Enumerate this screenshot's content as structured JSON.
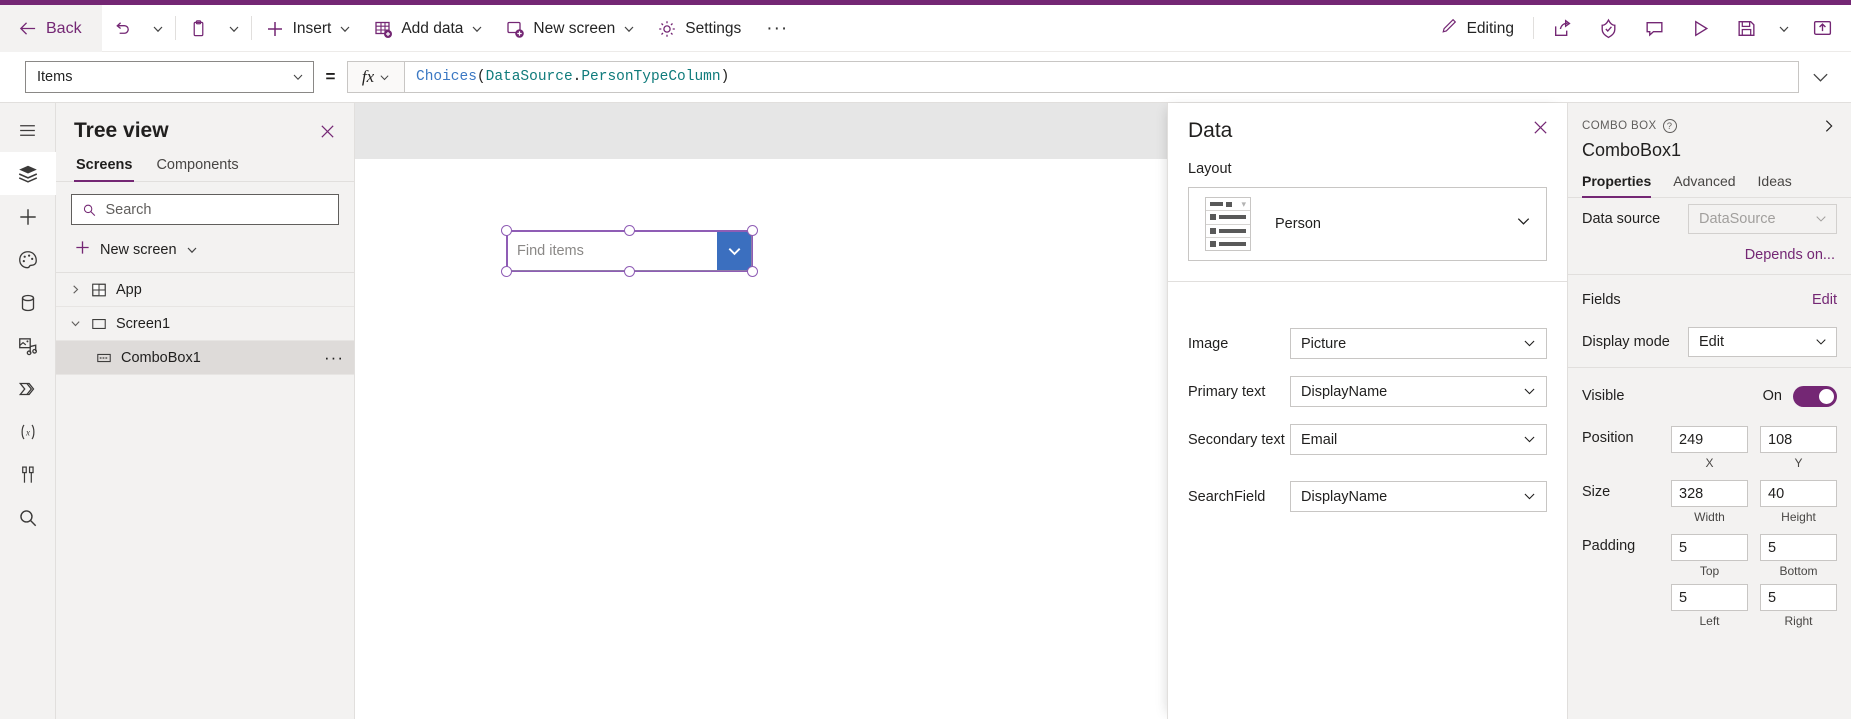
{
  "theme": {
    "accent": "#742774",
    "canvas_header": "#e6e6e6",
    "selection": "#8f5db5",
    "dropdown_blue": "#3b6fbf"
  },
  "commandbar": {
    "back_label": "Back",
    "undo_icon": "undo-icon",
    "undo_caret": "chevron-down-icon",
    "paste_icon": "clipboard-icon",
    "paste_caret": "chevron-down-icon",
    "insert_label": "Insert",
    "add_data_label": "Add data",
    "new_screen_label": "New screen",
    "settings_label": "Settings",
    "overflow_label": "···",
    "editing_label": "Editing",
    "share_icon": "share-icon",
    "checker_icon": "app-checker-icon",
    "comment_icon": "comment-icon",
    "preview_icon": "play-icon",
    "save_icon": "save-icon",
    "save_caret": "chevron-down-icon",
    "publish_icon": "publish-icon"
  },
  "formulabar": {
    "property": "Items",
    "equals": "=",
    "fx_label": "fx",
    "formula_parts": [
      {
        "text": "Choices",
        "color": "#3b78c3"
      },
      {
        "text": "(",
        "color": "#201f1e"
      },
      {
        "text": "DataSource",
        "color": "#0f7b7b"
      },
      {
        "text": ".",
        "color": "#201f1e"
      },
      {
        "text": "PersonTypeColumn",
        "color": "#0f7b7b"
      },
      {
        "text": ")",
        "color": "#201f1e"
      }
    ],
    "expand_icon": "chevron-down-icon"
  },
  "rail": {
    "items": [
      {
        "name": "hamburger-menu-icon",
        "active": false
      },
      {
        "name": "tree-view-icon",
        "active": true
      },
      {
        "name": "insert-icon",
        "active": false
      },
      {
        "name": "theme-palette-icon",
        "active": false
      },
      {
        "name": "data-sources-icon",
        "active": false
      },
      {
        "name": "media-icon",
        "active": false
      },
      {
        "name": "power-automate-icon",
        "active": false
      },
      {
        "name": "variables-icon",
        "active": false
      },
      {
        "name": "advanced-tools-icon",
        "active": false
      },
      {
        "name": "search-icon",
        "active": false
      }
    ]
  },
  "treeview": {
    "title": "Tree view",
    "close_icon": "close-icon",
    "tabs": [
      {
        "label": "Screens",
        "active": true
      },
      {
        "label": "Components",
        "active": false
      }
    ],
    "search_placeholder": "Search",
    "search_value": "",
    "new_screen_label": "New screen",
    "rows": [
      {
        "label": "App",
        "icon": "app-icon",
        "chevron": "chevron-right-icon",
        "indent": false,
        "selected": false,
        "more": ""
      },
      {
        "label": "Screen1",
        "icon": "screen-icon",
        "chevron": "chevron-down-icon",
        "indent": false,
        "selected": false,
        "more": ""
      },
      {
        "label": "ComboBox1",
        "icon": "combobox-icon",
        "chevron": "",
        "indent": true,
        "selected": true,
        "more": "···"
      }
    ]
  },
  "canvas": {
    "combobox": {
      "placeholder": "Find items",
      "dropdown_icon": "chevron-down-icon"
    }
  },
  "datapanel": {
    "title": "Data",
    "close_icon": "close-icon",
    "layout_label": "Layout",
    "layout_value": "Person",
    "layout_caret": "chevron-down-icon",
    "fields": [
      {
        "label": "Image",
        "value": "Picture"
      },
      {
        "label": "Primary text",
        "value": "DisplayName"
      },
      {
        "label": "Secondary text",
        "value": "Email"
      },
      {
        "label": "SearchField",
        "value": "DisplayName"
      }
    ]
  },
  "properties": {
    "kicker": "COMBO BOX",
    "help_glyph": "?",
    "expand_icon": "chevron-right-icon",
    "control_name": "ComboBox1",
    "tabs": [
      {
        "label": "Properties",
        "active": true
      },
      {
        "label": "Advanced",
        "active": false
      },
      {
        "label": "Ideas",
        "active": false
      }
    ],
    "data_source_label": "Data source",
    "data_source_value": "DataSource",
    "depends_on_label": "Depends on...",
    "fields_label": "Fields",
    "fields_edit_label": "Edit",
    "display_mode_label": "Display mode",
    "display_mode_value": "Edit",
    "visible_label": "Visible",
    "visible_state": "On",
    "position_label": "Position",
    "position_x": "249",
    "position_y": "108",
    "position_x_cap": "X",
    "position_y_cap": "Y",
    "size_label": "Size",
    "size_width": "328",
    "size_height": "40",
    "size_width_cap": "Width",
    "size_height_cap": "Height",
    "padding_label": "Padding",
    "padding_top": "5",
    "padding_bottom": "5",
    "padding_left": "5",
    "padding_right": "5",
    "padding_top_cap": "Top",
    "padding_bottom_cap": "Bottom",
    "padding_left_cap": "Left",
    "padding_right_cap": "Right"
  }
}
